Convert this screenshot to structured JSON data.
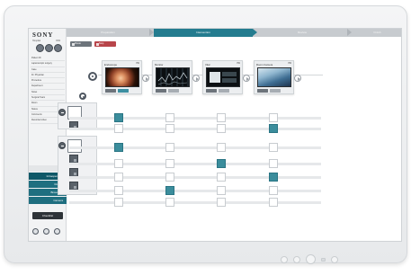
{
  "brand": {
    "logo": "SONY",
    "sub_left": "Hospital",
    "sub_right": "OR1"
  },
  "mode_buttons": [
    {
      "name": "mode-a",
      "icon": "circle-a-icon"
    },
    {
      "name": "mode-b",
      "icon": "circle-b-icon"
    },
    {
      "name": "mode-c",
      "icon": "circle-c-icon"
    }
  ],
  "side_items": [
    "Patient ID",
    "Laparoscopic surgery",
    "Case",
    "Dr. Physician",
    "Procedure",
    "Department",
    "Notes",
    "Surgical Team",
    "Room",
    "Status",
    "Comments",
    "Recorded video"
  ],
  "side_tabs": [
    {
      "label": "Intraoperative",
      "selected": true
    },
    {
      "label": "Rooms",
      "selected": false
    },
    {
      "label": "Broadcast",
      "selected": false
    },
    {
      "label": "Camera",
      "selected": false
    }
  ],
  "checklist_label": "Checklist",
  "workflow_steps": [
    {
      "label": "Preparation",
      "active": false
    },
    {
      "label": "Intervention",
      "active": true
    },
    {
      "label": "Review",
      "active": false
    },
    {
      "label": "Finish",
      "active": false
    }
  ],
  "toolbar": {
    "btn1": "Route",
    "btn2": "Stop"
  },
  "sources": [
    {
      "title": "Endoscope",
      "badge": "HD",
      "image": "endoscope-feed"
    },
    {
      "title": "Monitor",
      "badge": "",
      "image": "monitor-feed"
    },
    {
      "title": "Vital",
      "badge": "HD",
      "image": "vital-feed"
    },
    {
      "title": "Room Camera",
      "badge": "HD",
      "image": "room-camera-feed"
    }
  ],
  "routing": {
    "rows": 7,
    "active_cells": [
      {
        "row": 0,
        "col": 0
      },
      {
        "row": 1,
        "col": 3
      },
      {
        "row": 2,
        "col": 0
      },
      {
        "row": 3,
        "col": 2
      },
      {
        "row": 4,
        "col": 3
      },
      {
        "row": 5,
        "col": 1
      }
    ]
  },
  "colors": {
    "accent": "#247c8f",
    "cell_on": "#3b8d9c",
    "sidebar_tab": "#1f6f80",
    "dark_gray": "#5a626a"
  }
}
